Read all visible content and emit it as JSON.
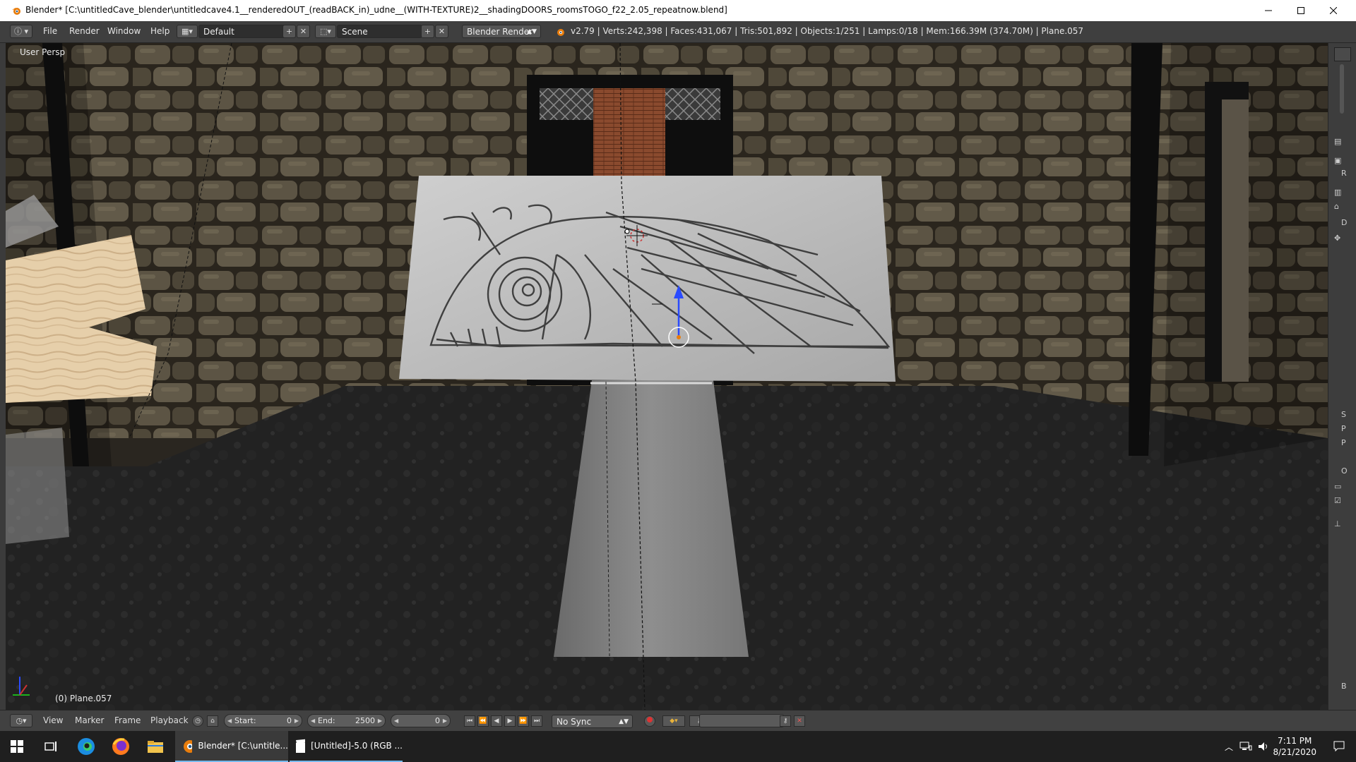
{
  "window": {
    "title": "Blender* [C:\\untitledCave_blender\\untitledcave4.1__renderedOUT_(readBACK_in)_udne__(WITH-TEXTURE)2__shadingDOORS_roomsTOGO_f22_2.05_repeatnow.blend]"
  },
  "info_header": {
    "menus": [
      "File",
      "Render",
      "Window",
      "Help"
    ],
    "screen_layout": "Default",
    "scene": "Scene",
    "render_engine": "Blender Render",
    "stats": "v2.79 | Verts:242,398 | Faces:431,067 | Tris:501,892 | Objects:1/251 | Lamps:0/18 | Mem:166.39M (374.70M) | Plane.057"
  },
  "viewport": {
    "view_label": "User Persp",
    "object_label": "(0) Plane.057"
  },
  "right_strip": {
    "letters": [
      "R",
      "D",
      "S",
      "P",
      "P",
      "O",
      "B"
    ]
  },
  "timeline": {
    "menus": [
      "View",
      "Marker",
      "Frame",
      "Playback"
    ],
    "start_label": "Start:",
    "start_value": "0",
    "end_label": "End:",
    "end_value": "2500",
    "current_frame": "0",
    "sync": "No Sync"
  },
  "taskbar": {
    "apps": [
      {
        "label": "Blender* [C:\\untitle..."
      },
      {
        "label": "[Untitled]-5.0 (RGB ..."
      }
    ],
    "time": "7:11 PM",
    "date": "8/21/2020"
  },
  "colors": {
    "header_bg": "#3f3f3f",
    "timeline_bg": "#414141",
    "taskbar_bg": "#1f1f1f",
    "blender_orange": "#e87d0d",
    "gizmo_blue": "#2a4bff"
  }
}
